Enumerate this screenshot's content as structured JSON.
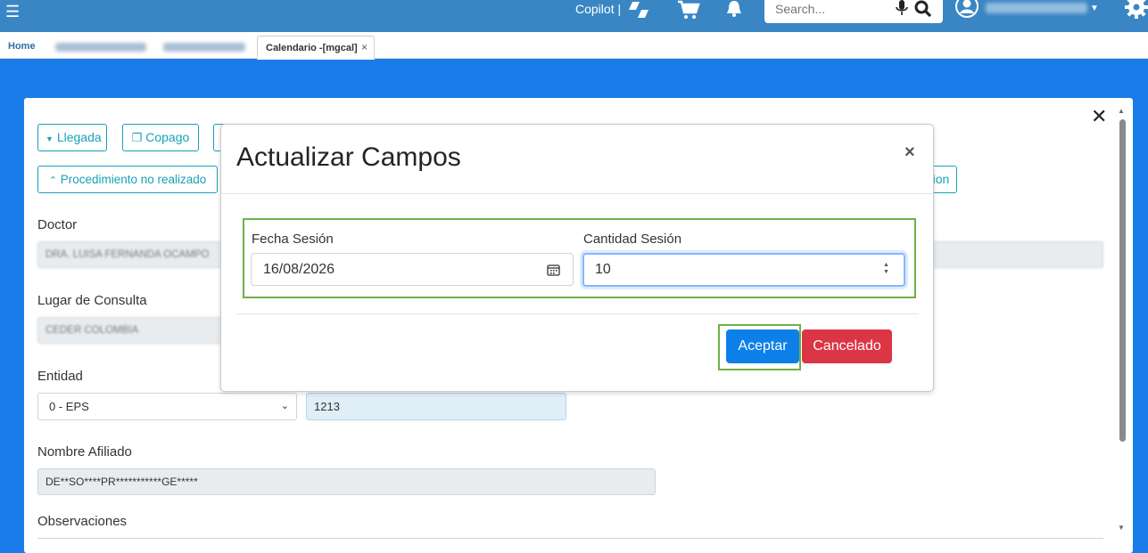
{
  "topbar": {
    "menu_icon": "menu-icon",
    "copilot_label": "Copilot |",
    "search_placeholder": "Search...",
    "icons": [
      "copilot-logo-icon",
      "cart-icon",
      "bell-icon",
      "mic-icon",
      "search-icon",
      "user-avatar-icon",
      "chevron-down-icon",
      "gear-icon"
    ]
  },
  "tabs": {
    "home": "Home",
    "active": "Calendario -[mgcal]",
    "close_glyph": "×"
  },
  "panel": {
    "close_glyph": "✕",
    "buttons": {
      "llegada": "Llegada",
      "copago": "Copago",
      "procedimiento": "Procedimiento no realizado",
      "partial_right": "ion"
    },
    "fields": {
      "doctor_label": "Doctor",
      "doctor_value": "DRA. LUISA FERNANDA OCAMPO",
      "lugar_label": "Lugar de Consulta",
      "lugar_value": "CEDER COLOMBIA",
      "entidad_label": "Entidad",
      "entidad_selected": "0 - EPS",
      "entidad_code": "1213",
      "afiliado_label": "Nombre Afiliado",
      "afiliado_value": "DE**SO****PR***********GE*****",
      "observaciones_label": "Observaciones"
    }
  },
  "modal": {
    "title": "Actualizar Campos",
    "close_glyph": "×",
    "fecha_label": "Fecha Sesión",
    "fecha_value": "16/08/2026",
    "cantidad_label": "Cantidad Sesión",
    "cantidad_value": "10",
    "accept_label": "Aceptar",
    "cancel_label": "Cancelado"
  },
  "colors": {
    "topbar": "#3a86c4",
    "background": "#1a7ce8",
    "accent_info": "#17a2b8",
    "primary": "#0d7fe8",
    "danger": "#dc3545",
    "highlight": "#70b048"
  }
}
